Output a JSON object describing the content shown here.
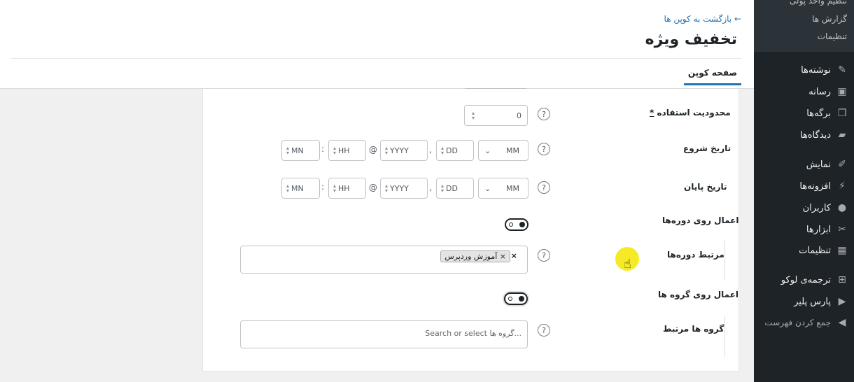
{
  "sidebar": {
    "submenu": [
      "تنظیم واحد پولی",
      "گزارش ها",
      "تنظیمات"
    ],
    "items": [
      {
        "label": "نوشته‌ها",
        "icon": "pin-icon",
        "glyph": "✎"
      },
      {
        "label": "رسانه",
        "icon": "media-icon",
        "glyph": "▣"
      },
      {
        "label": "برگه‌ها",
        "icon": "pages-icon",
        "glyph": "❐"
      },
      {
        "label": "دیدگاه‌ها",
        "icon": "comments-icon",
        "glyph": "▰"
      },
      {
        "label": "نمایش",
        "icon": "appearance-icon",
        "glyph": "✐"
      },
      {
        "label": "افزونه‌ها",
        "icon": "plugins-icon",
        "glyph": "⚡"
      },
      {
        "label": "کاربران",
        "icon": "users-icon",
        "glyph": "●"
      },
      {
        "label": "ابزارها",
        "icon": "tools-icon",
        "glyph": "✂"
      },
      {
        "label": "تنظیمات",
        "icon": "settings-icon",
        "glyph": "▦"
      },
      {
        "label": "ترجمه‌ی لوکو",
        "icon": "translate-icon",
        "glyph": "⊞"
      },
      {
        "label": "پارس پلیر",
        "icon": "player-icon",
        "glyph": "▶"
      },
      {
        "label": "جمع کردن فهرست",
        "icon": "collapse-icon",
        "glyph": "◀"
      }
    ]
  },
  "header": {
    "back_link": "← بازگشت به کوپن ها",
    "title": "تخفیف ویژه",
    "tab": "صفحه کوپن"
  },
  "form": {
    "usage_limit": {
      "label": "محدودیت استفاده",
      "required_mark": "*",
      "value": "0"
    },
    "start_date": {
      "label": "تاریخ شروع",
      "month": "MM",
      "day": "DD",
      "year": "YYYY",
      "hour": "HH",
      "minute": "MN",
      "sep_comma": ",",
      "sep_at": "@",
      "sep_colon": ":"
    },
    "end_date": {
      "label": "تاریخ پایان",
      "month": "MM",
      "day": "DD",
      "year": "YYYY",
      "hour": "HH",
      "minute": "MN",
      "sep_comma": ",",
      "sep_at": "@",
      "sep_colon": ":"
    },
    "apply_courses": {
      "label": "اعمال روی دوره‌ها",
      "enabled": false
    },
    "related_courses": {
      "label": "مرتبط دوره‌ها",
      "tag": "× آموزش وردپرس",
      "clear": "×"
    },
    "apply_groups": {
      "label": "اعمال روی گروه ها",
      "enabled": false
    },
    "related_groups": {
      "label": "گروه ها مرتبط",
      "placeholder": "Search or select گروه ها..."
    }
  },
  "colors": {
    "accent": "#2271b1",
    "sidebar": "#1d2327",
    "highlight": "#f5e600"
  }
}
